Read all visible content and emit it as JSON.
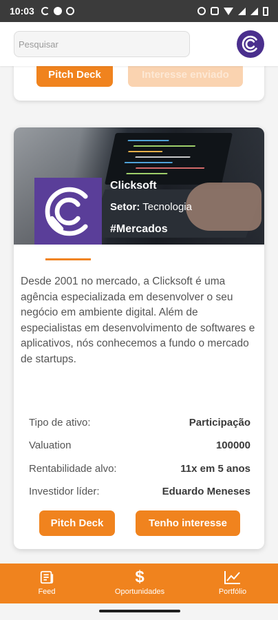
{
  "status_bar": {
    "time": "10:03",
    "icons": [
      "g-icon",
      "circle-icon",
      "shield-icon",
      "alarm-icon",
      "mute-icon",
      "wifi-icon",
      "signal-icon",
      "signal-icon",
      "battery-icon"
    ]
  },
  "header": {
    "search_placeholder": "Pesquisar",
    "logo_icon": "clicksoft-logo-icon"
  },
  "previous_card": {
    "pitch_deck_label": "Pitch Deck",
    "interest_label": "Interesse enviado"
  },
  "card": {
    "company_name": "Clicksoft",
    "sector_label": "Setor:",
    "sector_value": "Tecnologia",
    "tag": "#Mercados",
    "description": "Desde 2001 no mercado, a Clicksoft é uma agência especializada em desenvolver o seu negócio em ambiente digital. Além de especialistas em desenvolvimento de softwares e aplicativos, nós conhecemos a fundo o mercado de startups.",
    "info": [
      {
        "label": "Tipo de ativo:",
        "value": "Participação"
      },
      {
        "label": "Valuation",
        "value": "100000"
      },
      {
        "label": "Rentabilidade alvo:",
        "value": "11x em 5 anos"
      },
      {
        "label": "Investidor líder:",
        "value": "Eduardo Meneses"
      }
    ],
    "pitch_deck_label": "Pitch Deck",
    "interest_label": "Tenho interesse"
  },
  "bottom_nav": {
    "items": [
      {
        "label": "Feed",
        "icon": "newspaper-icon"
      },
      {
        "label": "Oportunidades",
        "icon": "dollar-icon"
      },
      {
        "label": "Portfólio",
        "icon": "chart-line-icon"
      }
    ]
  },
  "colors": {
    "accent": "#f0831e",
    "brand_purple": "#5a3e99"
  }
}
